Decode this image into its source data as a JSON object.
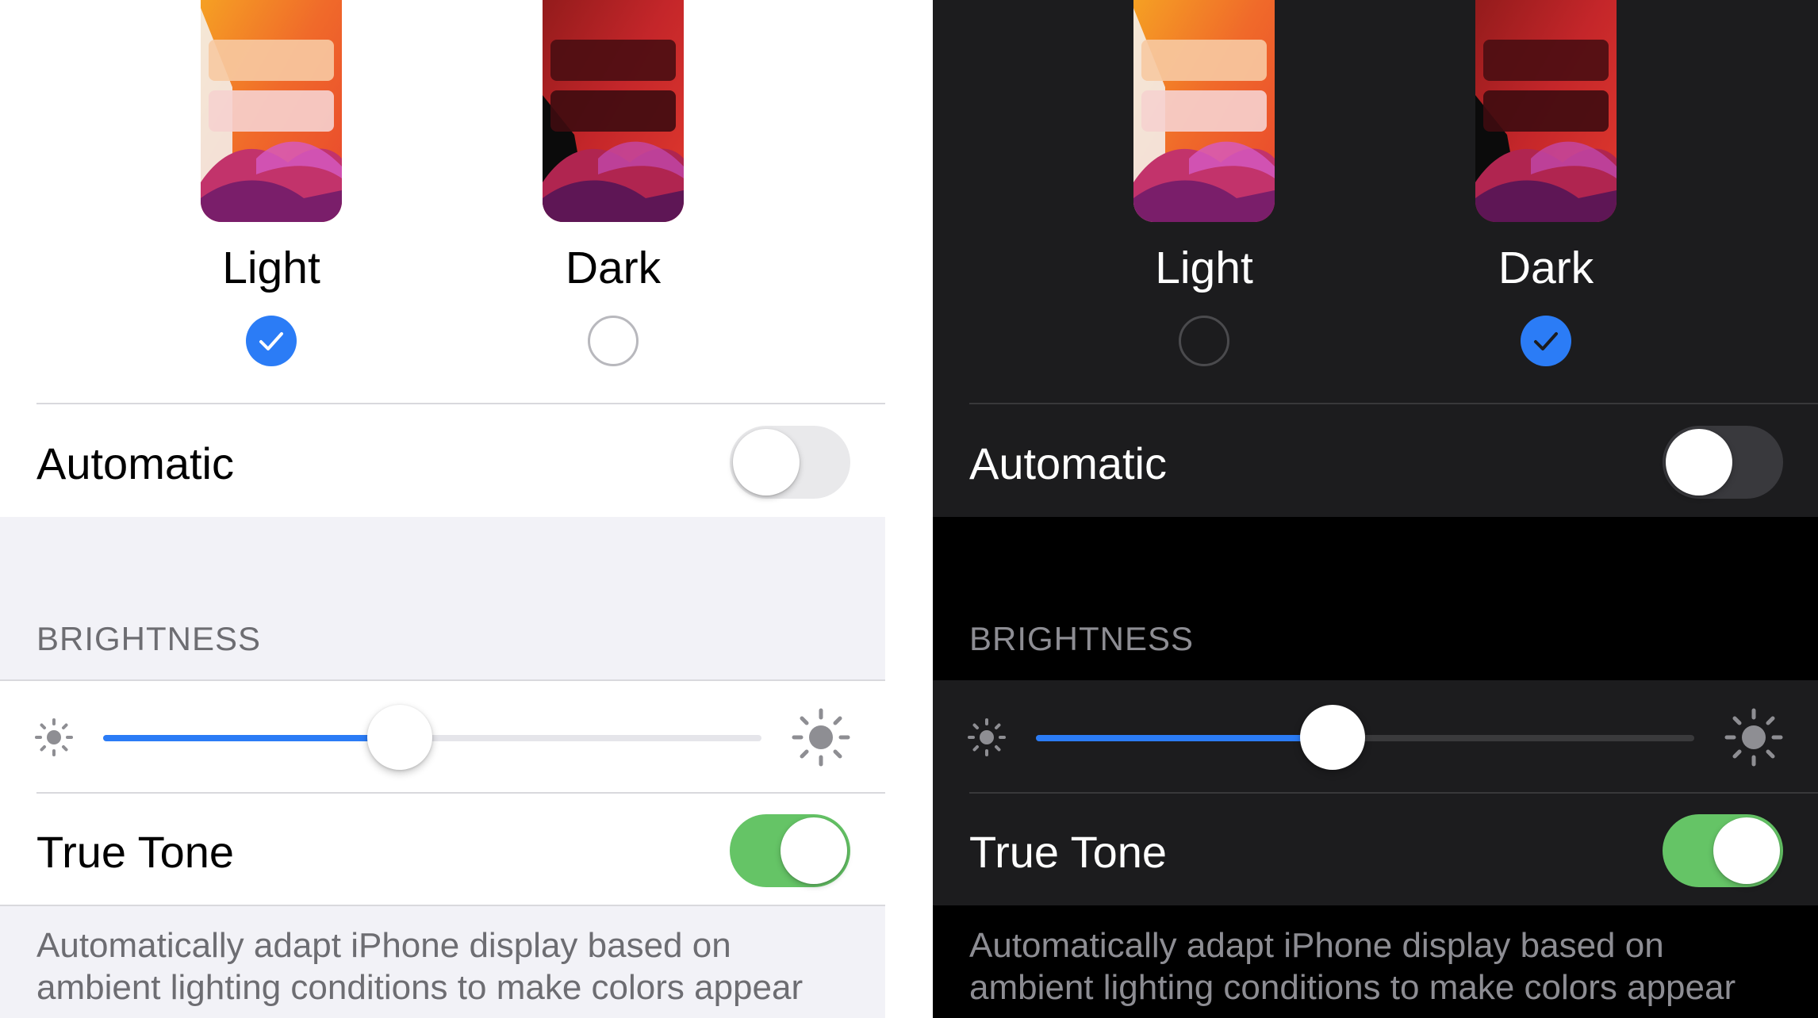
{
  "light_panel": {
    "appearance": {
      "options": [
        {
          "label": "Light",
          "selected": true
        },
        {
          "label": "Dark",
          "selected": false
        }
      ]
    },
    "automatic": {
      "label": "Automatic",
      "on": false
    },
    "brightness": {
      "header": "BRIGHTNESS",
      "level": 0.45,
      "min_icon": "sun-small-icon",
      "max_icon": "sun-large-icon"
    },
    "true_tone": {
      "label": "True Tone",
      "on": true
    },
    "footer": "Automatically adapt iPhone display based on ambient lighting conditions to make colors appear"
  },
  "dark_panel": {
    "appearance": {
      "options": [
        {
          "label": "Light",
          "selected": false
        },
        {
          "label": "Dark",
          "selected": true
        }
      ]
    },
    "automatic": {
      "label": "Automatic",
      "on": false
    },
    "brightness": {
      "header": "BRIGHTNESS",
      "level": 0.45,
      "min_icon": "sun-small-icon",
      "max_icon": "sun-large-icon"
    },
    "true_tone": {
      "label": "True Tone",
      "on": true
    },
    "footer": "Automatically adapt iPhone display based on ambient lighting conditions to make colors appear"
  },
  "colors": {
    "accent_blue": "#2b7cf6",
    "toggle_green": "#65c466",
    "dark_background": "#000000",
    "dark_card": "#1c1c1e",
    "light_background": "#f2f2f7"
  }
}
